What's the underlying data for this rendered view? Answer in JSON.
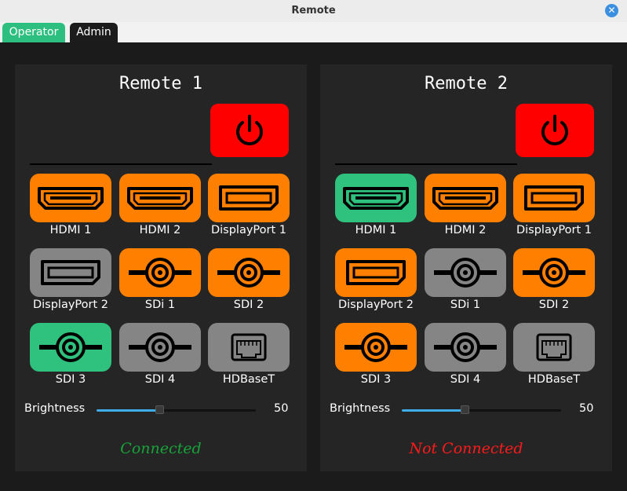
{
  "window": {
    "title": "Remote"
  },
  "tabs": [
    {
      "label": "Operator"
    },
    {
      "label": "Admin"
    }
  ],
  "remotes": [
    {
      "title": "Remote 1",
      "inputs": [
        {
          "label": "HDMI 1",
          "icon": "hdmi-icon",
          "state": "orange"
        },
        {
          "label": "HDMI 2",
          "icon": "hdmi-icon",
          "state": "orange"
        },
        {
          "label": "DisplayPort 1",
          "icon": "displayport-icon",
          "state": "orange"
        },
        {
          "label": "DisplayPort 2",
          "icon": "displayport-icon",
          "state": "gray"
        },
        {
          "label": "SDi 1",
          "icon": "sdi-icon",
          "state": "orange"
        },
        {
          "label": "SDI 2",
          "icon": "sdi-icon",
          "state": "orange"
        },
        {
          "label": "SDI 3",
          "icon": "sdi-icon",
          "state": "green"
        },
        {
          "label": "SDI 4",
          "icon": "sdi-icon",
          "state": "gray"
        },
        {
          "label": "HDBaseT",
          "icon": "ethernet-icon",
          "state": "gray"
        }
      ],
      "brightness_label": "Brightness",
      "brightness_value": "50",
      "brightness_fraction": 0.5,
      "status": "Connected",
      "status_color": "#18a33a"
    },
    {
      "title": "Remote 2",
      "inputs": [
        {
          "label": "HDMI 1",
          "icon": "hdmi-icon",
          "state": "green"
        },
        {
          "label": "HDMI 2",
          "icon": "hdmi-icon",
          "state": "orange"
        },
        {
          "label": "DisplayPort 1",
          "icon": "displayport-icon",
          "state": "orange"
        },
        {
          "label": "DisplayPort 2",
          "icon": "displayport-icon",
          "state": "orange"
        },
        {
          "label": "SDi 1",
          "icon": "sdi-icon",
          "state": "gray"
        },
        {
          "label": "SDI 2",
          "icon": "sdi-icon",
          "state": "orange"
        },
        {
          "label": "SDI 3",
          "icon": "sdi-icon",
          "state": "orange"
        },
        {
          "label": "SDI 4",
          "icon": "sdi-icon",
          "state": "gray"
        },
        {
          "label": "HDBaseT",
          "icon": "ethernet-icon",
          "state": "gray"
        }
      ],
      "brightness_label": "Brightness",
      "brightness_value": "50",
      "brightness_fraction": 0.5,
      "status": "Not Connected",
      "status_color": "#ff1a1a"
    }
  ],
  "colors": {
    "orange": "#ff8000",
    "gray": "#858585",
    "green": "#2ec27e",
    "power": "#ff0000",
    "accent": "#3daee9"
  }
}
